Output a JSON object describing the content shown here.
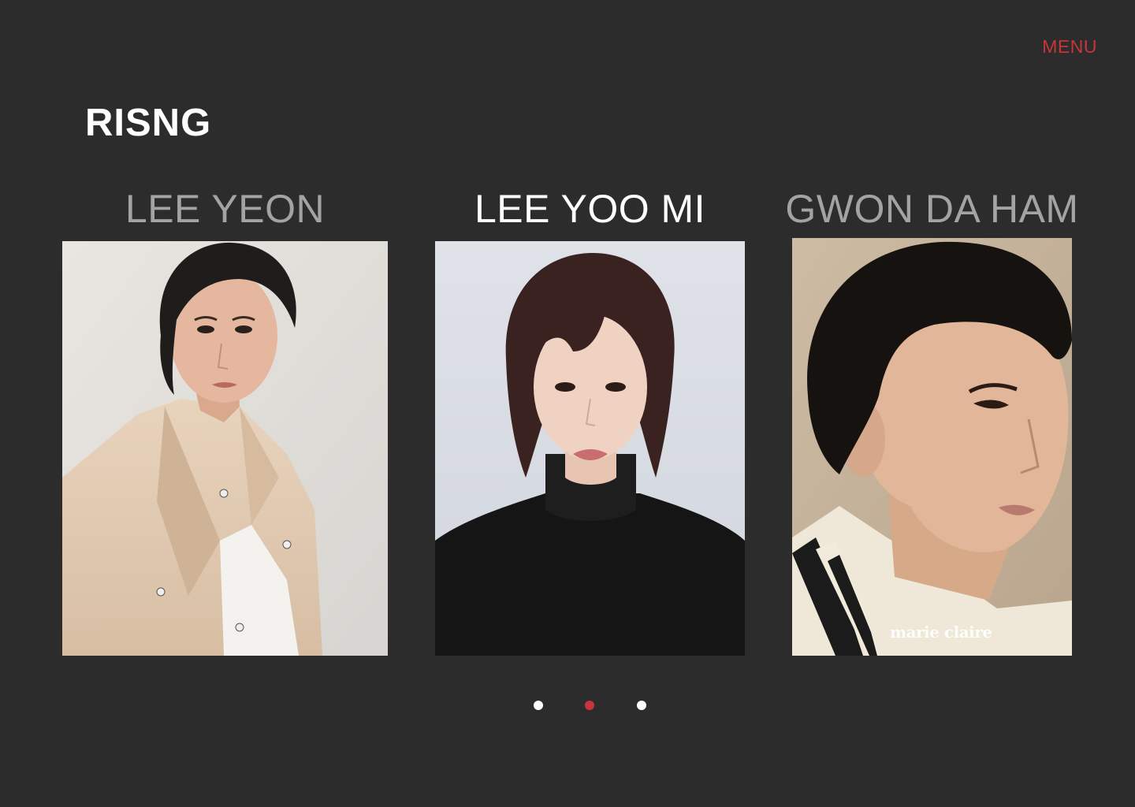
{
  "header": {
    "menu_label": "MENU",
    "section_title": "RISNG"
  },
  "profiles": [
    {
      "name": "LEE YEON",
      "photo_alt": "LEE YEON",
      "active": false
    },
    {
      "name": "LEE YOO MI",
      "photo_alt": "LEE YOO MI",
      "active": true
    },
    {
      "name": "GWON DA HAM",
      "photo_alt": "GWON DA HAM",
      "active": false,
      "watermark": "marie claire"
    }
  ],
  "pagination": {
    "total": 3,
    "active_index": 1
  },
  "colors": {
    "background": "#2c2c2c",
    "accent": "#c6353a",
    "text_primary": "#ffffff",
    "text_dim": "#a3a3a3"
  }
}
